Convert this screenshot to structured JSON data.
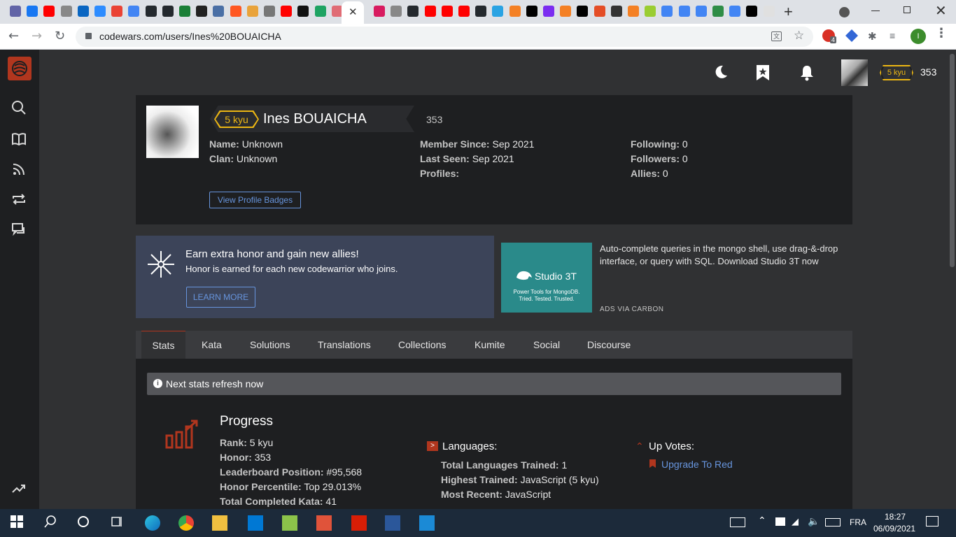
{
  "browser": {
    "url": "codewars.com/users/Ines%20BOUAICHA",
    "tab_favicon_colors": [
      "#6264a7",
      "#1877f2",
      "#ff0000",
      "#888888",
      "#0a66c2",
      "#2d8cff",
      "#ea4335",
      "#4285f4",
      "#24292e",
      "#24292e",
      "#1a7f37",
      "#222222",
      "#4a6fa5",
      "#ff5722",
      "#e9a33b",
      "#777777",
      "#ff0000",
      "#111111",
      "#1ea362",
      "#e06c75",
      "#d81b60",
      "#888888",
      "#24292e",
      "#ff0000",
      "#ff0000",
      "#ff0000",
      "#24292e",
      "#2aa3e3",
      "#f48024",
      "#000000",
      "#7b2cf0",
      "#f48024",
      "#000000",
      "#e44d26",
      "#333333",
      "#f48024",
      "#9acd32",
      "#4285f4",
      "#4285f4",
      "#4285f4",
      "#2f8d46",
      "#4285f4",
      "#000000",
      "#e0e0e0",
      "#888888"
    ],
    "active_tab_close": "✕",
    "new_tab": "+",
    "profile_initial": "I",
    "extension_badge": "4"
  },
  "sidebar": {
    "items": [
      "search-icon",
      "book-icon",
      "rss-icon",
      "repeat-icon",
      "chat-icon",
      "trending-icon"
    ]
  },
  "topbar": {
    "rank": "5 kyu",
    "honor": "353"
  },
  "profile": {
    "rank": "5 kyu",
    "name": "Ines BOUAICHA",
    "honor": "353",
    "name_label": "Name:",
    "name_value": "Unknown",
    "clan_label": "Clan:",
    "clan_value": "Unknown",
    "member_since_label": "Member Since:",
    "member_since_value": "Sep 2021",
    "last_seen_label": "Last Seen:",
    "last_seen_value": "Sep 2021",
    "profiles_label": "Profiles:",
    "following_label": "Following:",
    "following_value": "0",
    "followers_label": "Followers:",
    "followers_value": "0",
    "allies_label": "Allies:",
    "allies_value": "0",
    "badges_button": "View Profile Badges"
  },
  "promo": {
    "title": "Earn extra honor and gain new allies!",
    "subtitle": "Honor is earned for each new codewarrior who joins.",
    "button": "LEARN MORE"
  },
  "ad": {
    "brand": "Studio 3T",
    "tag1": "Power Tools for MongoDB.",
    "tag2": "Tried. Tested. Trusted.",
    "text": "Auto-complete queries in the mongo shell, use drag-&-drop interface, or query with SQL. Download Studio 3T now",
    "via": "ADS VIA CARBON"
  },
  "tabs": [
    "Stats",
    "Kata",
    "Solutions",
    "Translations",
    "Collections",
    "Kumite",
    "Social",
    "Discourse"
  ],
  "stats": {
    "refresh": "Next stats refresh now",
    "progress_title": "Progress",
    "rank_label": "Rank:",
    "rank_value": "5 kyu",
    "honor_label": "Honor:",
    "honor_value": "353",
    "leaderboard_label": "Leaderboard Position:",
    "leaderboard_value": "#95,568",
    "percentile_label": "Honor Percentile:",
    "percentile_value": "Top 29.013%",
    "completed_label": "Total Completed Kata:",
    "completed_value": "41",
    "languages_title": "Languages:",
    "lang_total_label": "Total Languages Trained:",
    "lang_total_value": "1",
    "lang_highest_label": "Highest Trained:",
    "lang_highest_value": "JavaScript (5 kyu)",
    "lang_recent_label": "Most Recent:",
    "lang_recent_value": "JavaScript",
    "upvotes_title": "Up Votes:",
    "upgrade_link": "Upgrade To Red"
  },
  "taskbar": {
    "lang": "FRA",
    "time": "18:27",
    "date": "06/09/2021"
  }
}
